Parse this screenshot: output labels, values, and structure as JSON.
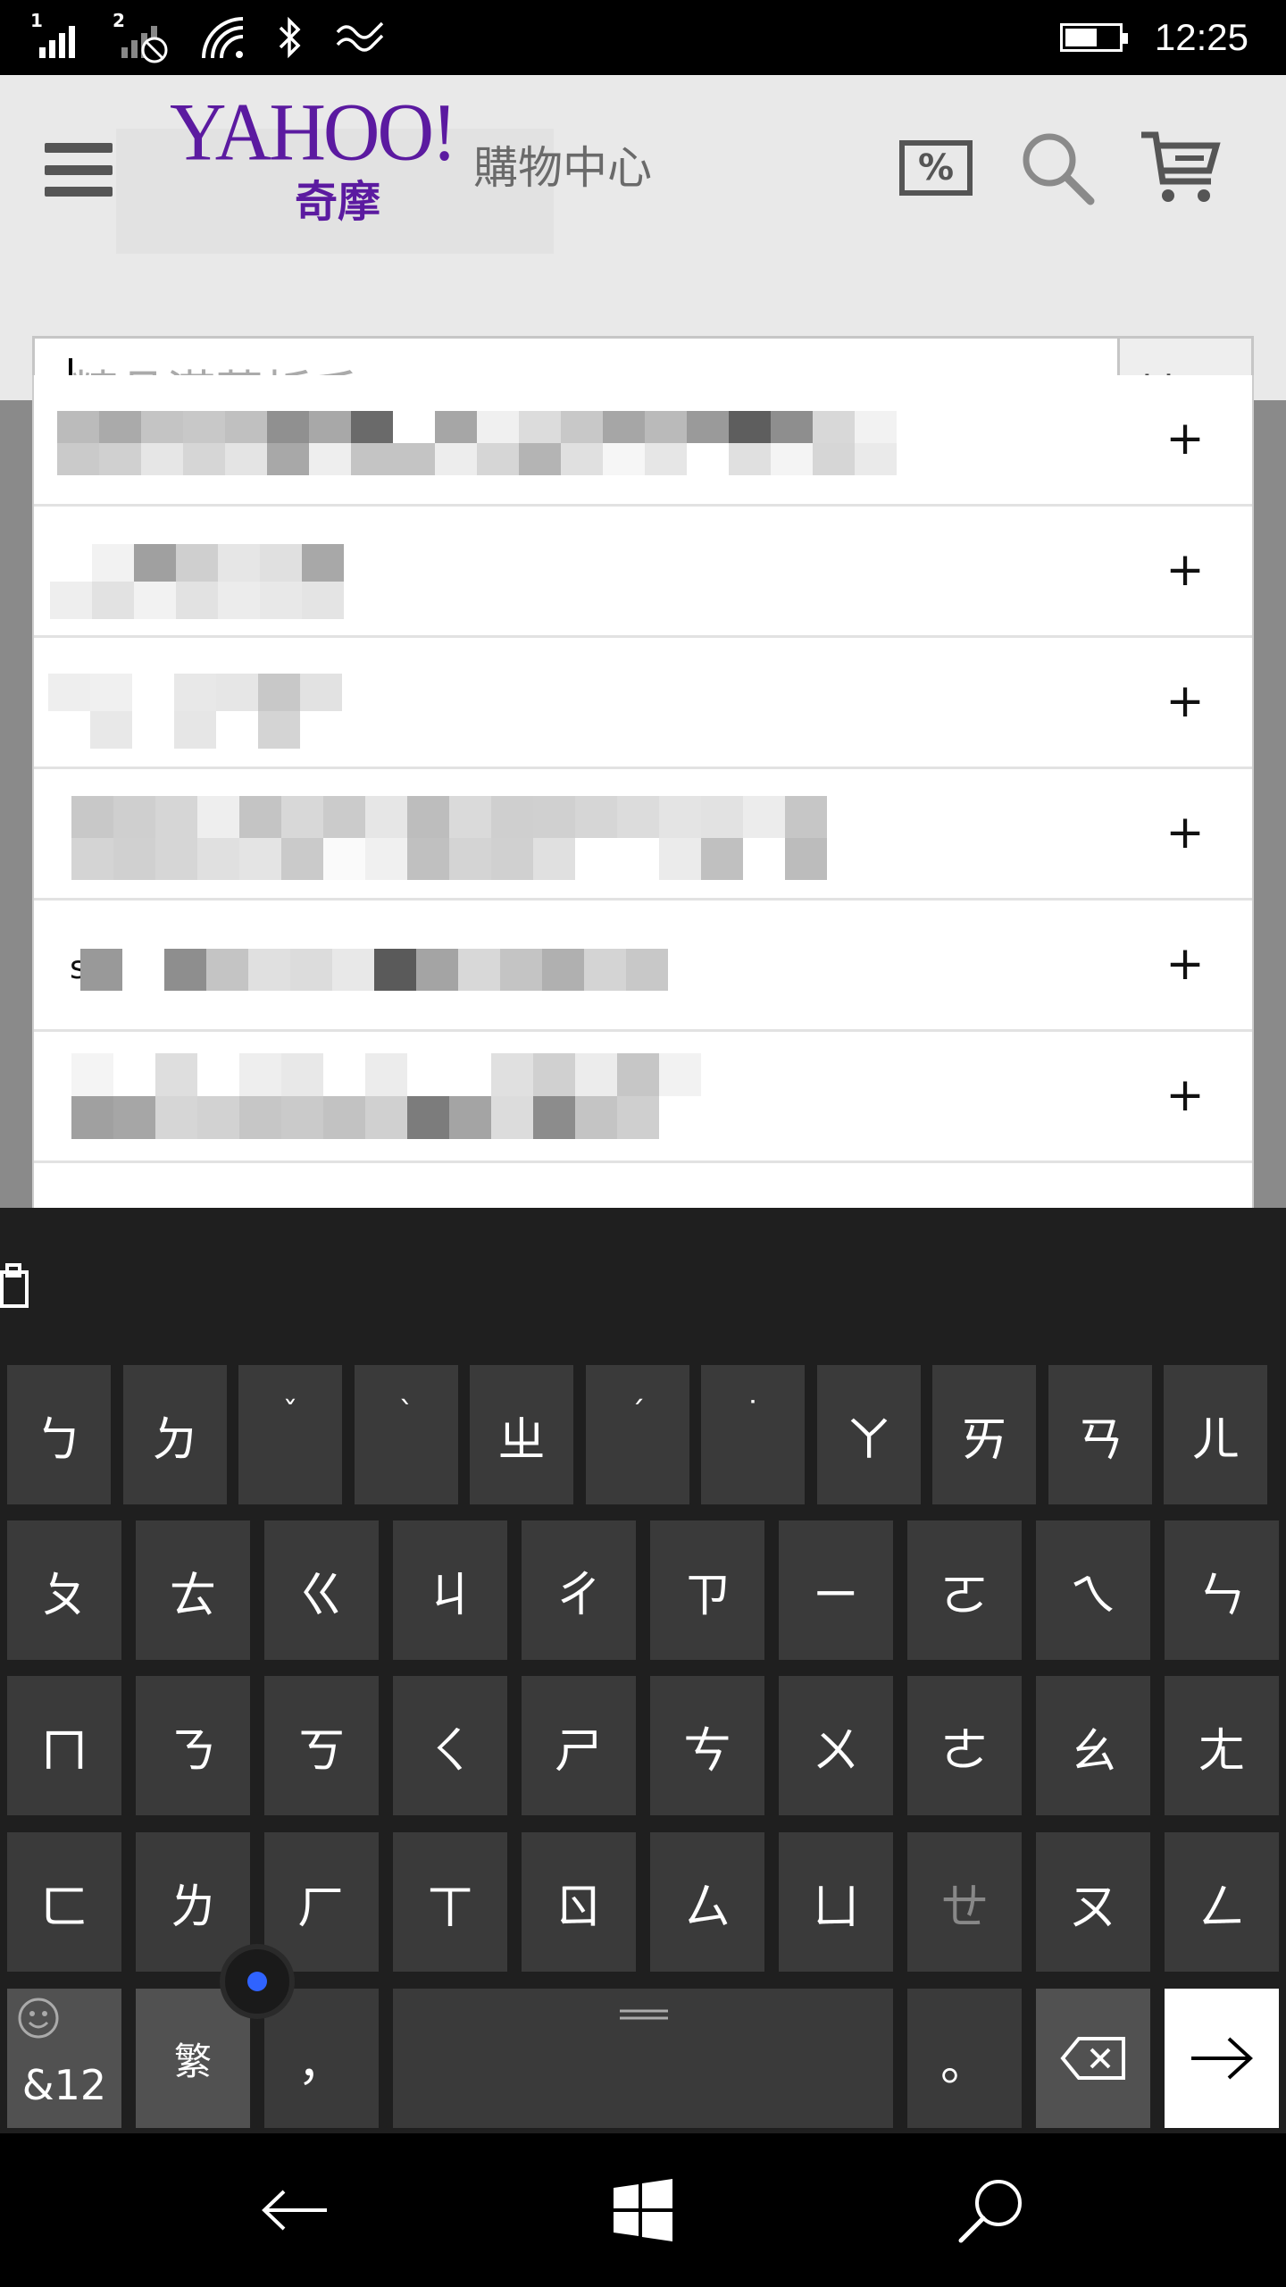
{
  "status_bar": {
    "sim1": "1",
    "sim2": "2",
    "battery_level": 0.6,
    "time": "12:25"
  },
  "header": {
    "logo_text": "YAHOO!",
    "logo_sub": "奇摩",
    "logo_mall": "購物中心",
    "coupon_label": "%",
    "icons": [
      "menu-icon",
      "coupon-icon",
      "search-icon",
      "cart-icon"
    ]
  },
  "search": {
    "placeholder": "精品滿萬折千",
    "value": "",
    "submit_label": "搜尋"
  },
  "suggestions": {
    "add_label": "+",
    "row5_lead": "s"
  },
  "keyboard": {
    "row1": [
      "ㄅ",
      "ㄉ",
      "ˇ",
      "ˋ",
      "ㄓ",
      "ˊ",
      "˙",
      "ㄚ",
      "ㄞ",
      "ㄢ",
      "ㄦ"
    ],
    "row2": [
      "ㄆ",
      "ㄊ",
      "ㄍ",
      "ㄐ",
      "ㄔ",
      "ㄗ",
      "ㄧ",
      "ㄛ",
      "ㄟ",
      "ㄣ"
    ],
    "row3": [
      "ㄇ",
      "ㄋ",
      "ㄎ",
      "ㄑ",
      "ㄕ",
      "ㄘ",
      "ㄨ",
      "ㄜ",
      "ㄠ",
      "ㄤ"
    ],
    "row4": [
      "ㄈ",
      "ㄌ",
      "ㄏ",
      "ㄒ",
      "ㄖ",
      "ㄙ",
      "ㄩ",
      "ㄝ",
      "ㄡ",
      "ㄥ"
    ],
    "symbols_label": "&12",
    "mode_label": "繁",
    "comma_label": "，",
    "period_label": "。",
    "icons": [
      "emoji-icon",
      "clipboard-icon",
      "backspace-icon",
      "enter-arrow-icon"
    ]
  },
  "nav_bar": {
    "icons": [
      "back-arrow-icon",
      "windows-start-icon",
      "search-icon"
    ]
  },
  "colors": {
    "yahoo_purple": "#5b1aa0",
    "status_bar_bg": "#000000",
    "keyboard_bg": "#1f1f1f",
    "key_bg": "#3a3a3a",
    "cursor_dot": "#2f63ff"
  }
}
